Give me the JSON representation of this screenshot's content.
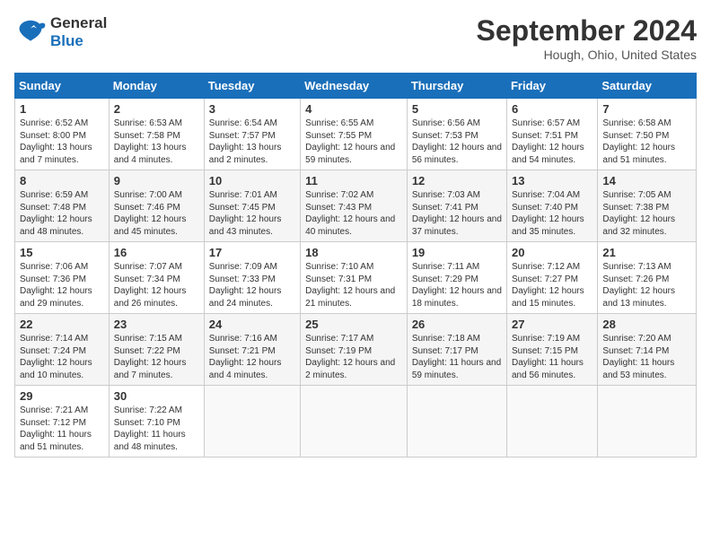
{
  "logo": {
    "text_general": "General",
    "text_blue": "Blue"
  },
  "title": "September 2024",
  "location": "Hough, Ohio, United States",
  "days_of_week": [
    "Sunday",
    "Monday",
    "Tuesday",
    "Wednesday",
    "Thursday",
    "Friday",
    "Saturday"
  ],
  "weeks": [
    [
      {
        "day": "1",
        "content": "Sunrise: 6:52 AM\nSunset: 8:00 PM\nDaylight: 13 hours and 7 minutes."
      },
      {
        "day": "2",
        "content": "Sunrise: 6:53 AM\nSunset: 7:58 PM\nDaylight: 13 hours and 4 minutes."
      },
      {
        "day": "3",
        "content": "Sunrise: 6:54 AM\nSunset: 7:57 PM\nDaylight: 13 hours and 2 minutes."
      },
      {
        "day": "4",
        "content": "Sunrise: 6:55 AM\nSunset: 7:55 PM\nDaylight: 12 hours and 59 minutes."
      },
      {
        "day": "5",
        "content": "Sunrise: 6:56 AM\nSunset: 7:53 PM\nDaylight: 12 hours and 56 minutes."
      },
      {
        "day": "6",
        "content": "Sunrise: 6:57 AM\nSunset: 7:51 PM\nDaylight: 12 hours and 54 minutes."
      },
      {
        "day": "7",
        "content": "Sunrise: 6:58 AM\nSunset: 7:50 PM\nDaylight: 12 hours and 51 minutes."
      }
    ],
    [
      {
        "day": "8",
        "content": "Sunrise: 6:59 AM\nSunset: 7:48 PM\nDaylight: 12 hours and 48 minutes."
      },
      {
        "day": "9",
        "content": "Sunrise: 7:00 AM\nSunset: 7:46 PM\nDaylight: 12 hours and 45 minutes."
      },
      {
        "day": "10",
        "content": "Sunrise: 7:01 AM\nSunset: 7:45 PM\nDaylight: 12 hours and 43 minutes."
      },
      {
        "day": "11",
        "content": "Sunrise: 7:02 AM\nSunset: 7:43 PM\nDaylight: 12 hours and 40 minutes."
      },
      {
        "day": "12",
        "content": "Sunrise: 7:03 AM\nSunset: 7:41 PM\nDaylight: 12 hours and 37 minutes."
      },
      {
        "day": "13",
        "content": "Sunrise: 7:04 AM\nSunset: 7:40 PM\nDaylight: 12 hours and 35 minutes."
      },
      {
        "day": "14",
        "content": "Sunrise: 7:05 AM\nSunset: 7:38 PM\nDaylight: 12 hours and 32 minutes."
      }
    ],
    [
      {
        "day": "15",
        "content": "Sunrise: 7:06 AM\nSunset: 7:36 PM\nDaylight: 12 hours and 29 minutes."
      },
      {
        "day": "16",
        "content": "Sunrise: 7:07 AM\nSunset: 7:34 PM\nDaylight: 12 hours and 26 minutes."
      },
      {
        "day": "17",
        "content": "Sunrise: 7:09 AM\nSunset: 7:33 PM\nDaylight: 12 hours and 24 minutes."
      },
      {
        "day": "18",
        "content": "Sunrise: 7:10 AM\nSunset: 7:31 PM\nDaylight: 12 hours and 21 minutes."
      },
      {
        "day": "19",
        "content": "Sunrise: 7:11 AM\nSunset: 7:29 PM\nDaylight: 12 hours and 18 minutes."
      },
      {
        "day": "20",
        "content": "Sunrise: 7:12 AM\nSunset: 7:27 PM\nDaylight: 12 hours and 15 minutes."
      },
      {
        "day": "21",
        "content": "Sunrise: 7:13 AM\nSunset: 7:26 PM\nDaylight: 12 hours and 13 minutes."
      }
    ],
    [
      {
        "day": "22",
        "content": "Sunrise: 7:14 AM\nSunset: 7:24 PM\nDaylight: 12 hours and 10 minutes."
      },
      {
        "day": "23",
        "content": "Sunrise: 7:15 AM\nSunset: 7:22 PM\nDaylight: 12 hours and 7 minutes."
      },
      {
        "day": "24",
        "content": "Sunrise: 7:16 AM\nSunset: 7:21 PM\nDaylight: 12 hours and 4 minutes."
      },
      {
        "day": "25",
        "content": "Sunrise: 7:17 AM\nSunset: 7:19 PM\nDaylight: 12 hours and 2 minutes."
      },
      {
        "day": "26",
        "content": "Sunrise: 7:18 AM\nSunset: 7:17 PM\nDaylight: 11 hours and 59 minutes."
      },
      {
        "day": "27",
        "content": "Sunrise: 7:19 AM\nSunset: 7:15 PM\nDaylight: 11 hours and 56 minutes."
      },
      {
        "day": "28",
        "content": "Sunrise: 7:20 AM\nSunset: 7:14 PM\nDaylight: 11 hours and 53 minutes."
      }
    ],
    [
      {
        "day": "29",
        "content": "Sunrise: 7:21 AM\nSunset: 7:12 PM\nDaylight: 11 hours and 51 minutes."
      },
      {
        "day": "30",
        "content": "Sunrise: 7:22 AM\nSunset: 7:10 PM\nDaylight: 11 hours and 48 minutes."
      },
      {
        "day": "",
        "content": ""
      },
      {
        "day": "",
        "content": ""
      },
      {
        "day": "",
        "content": ""
      },
      {
        "day": "",
        "content": ""
      },
      {
        "day": "",
        "content": ""
      }
    ]
  ]
}
